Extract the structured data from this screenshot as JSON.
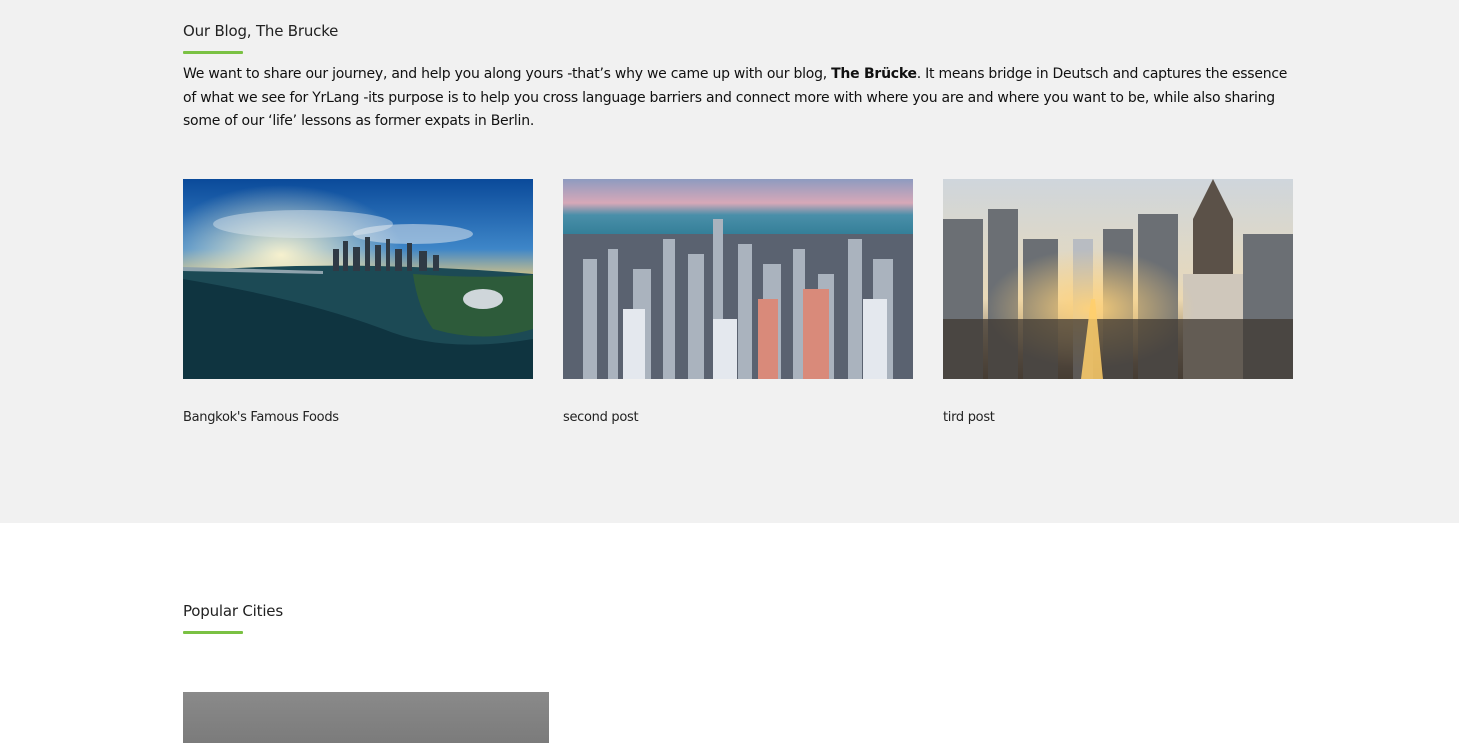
{
  "blog": {
    "title": "Our Blog, The Brucke",
    "intro_before": "We want to share our journey, and help you along yours -that’s why we came up with our blog, ",
    "intro_brand": "The Brücke",
    "intro_after": ". It means bridge in Deutsch and captures the essence of what we see for YrLang -its purpose is to help you cross language barriers and connect more with where you are and where you want to be, while also sharing some of our ‘life’ lessons as former expats in Berlin.",
    "posts": [
      {
        "title": "Bangkok's Famous Foods",
        "image": "aerial-bay-skyline-sunset-image"
      },
      {
        "title": "second post",
        "image": "aerial-lakefront-city-image"
      },
      {
        "title": "tird post",
        "image": "skyscrapers-sunset-street-image"
      }
    ]
  },
  "popular": {
    "title": "Popular Cities",
    "first_image": "city-photo-image"
  },
  "colors": {
    "accent": "#7ac143",
    "section_bg": "#f1f1f1"
  }
}
